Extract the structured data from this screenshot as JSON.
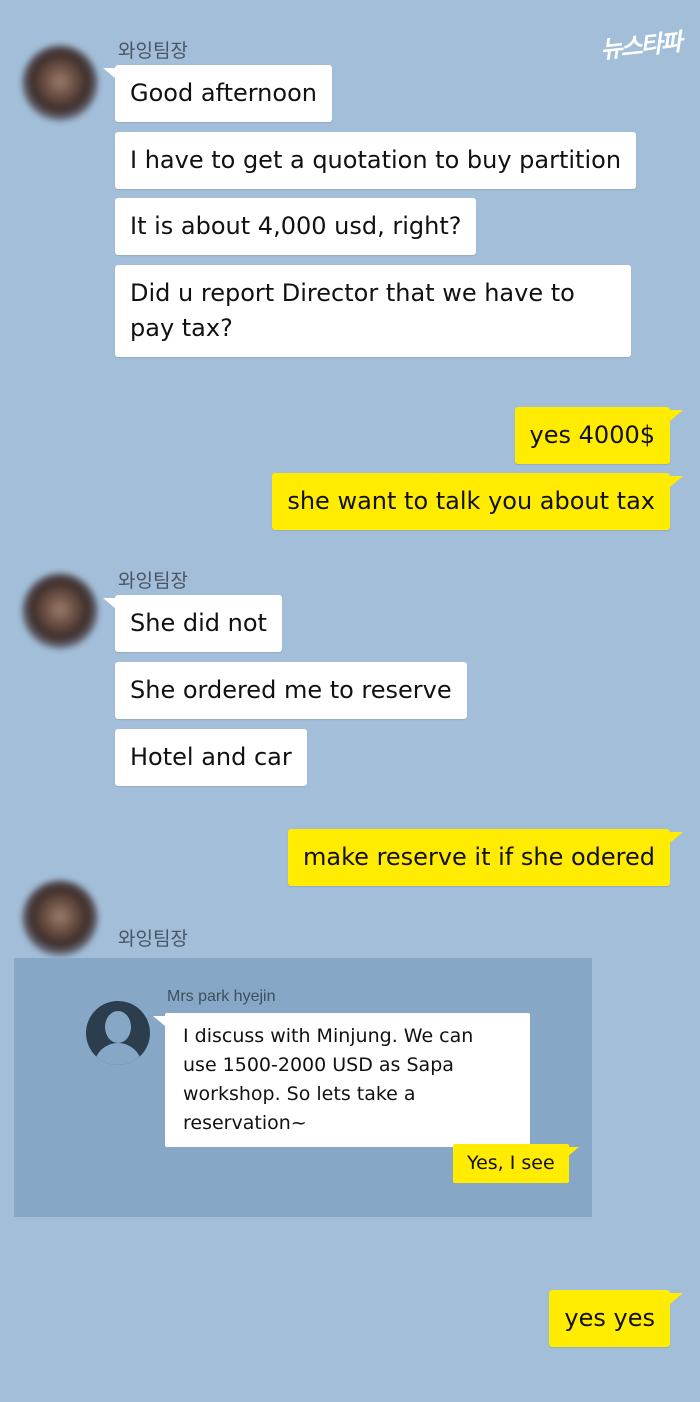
{
  "watermark": "뉴스타파",
  "messages": {
    "sender_name": "와잉팀장",
    "group1": [
      "Good afternoon",
      "I have to get a quotation to buy partition",
      "It is about 4,000 usd, right?",
      "Did u report Director that we have to pay tax?"
    ],
    "reply1": [
      "yes 4000$",
      "she want to talk you about tax"
    ],
    "group2": [
      "She did not",
      "She ordered me to reserve",
      "Hotel and car"
    ],
    "reply2": [
      "make reserve it if she odered"
    ],
    "forwarded": {
      "sender": "Mrs park hyejin",
      "text": "I discuss with Minjung. We can use 1500-2000 USD as Sapa workshop. So lets take a reservation~",
      "reply": "Yes, I see"
    },
    "reply3": [
      "yes yes"
    ]
  },
  "colors": {
    "background": "#a2bed8",
    "outgoing_bubble": "#ffec00",
    "incoming_bubble": "#ffffff",
    "quote_box": "#86a8c6"
  }
}
